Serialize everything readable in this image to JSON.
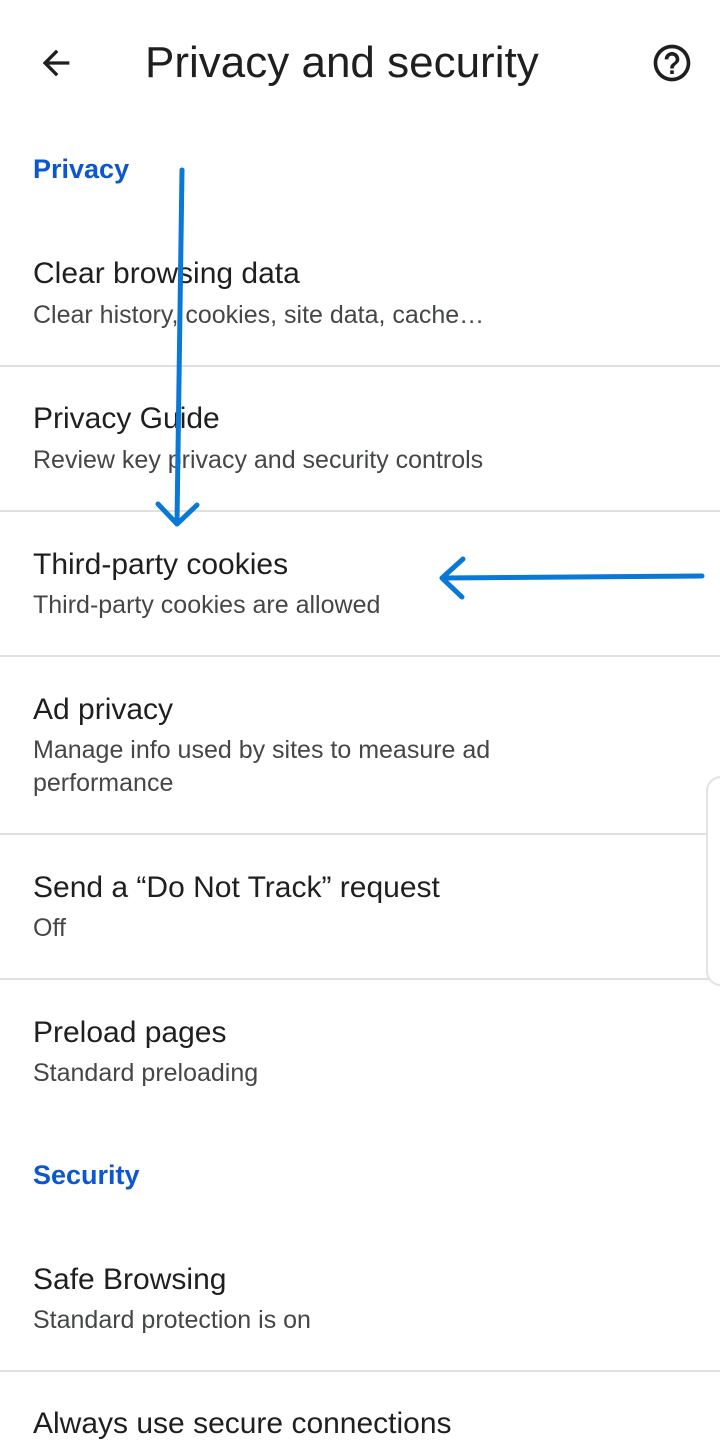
{
  "header": {
    "title": "Privacy and security",
    "back_icon": "arrow-back-icon",
    "help_icon": "help-circle-icon"
  },
  "sections": {
    "privacy_label": "Privacy",
    "security_label": "Security"
  },
  "privacy_items": [
    {
      "title": "Clear browsing data",
      "summary": "Clear history, cookies, site data, cache…"
    },
    {
      "title": "Privacy Guide",
      "summary": "Review key privacy and security controls"
    },
    {
      "title": "Third-party cookies",
      "summary": "Third-party cookies are allowed"
    },
    {
      "title": "Ad privacy",
      "summary": "Manage info used by sites to measure ad performance"
    },
    {
      "title": "Send a “Do Not Track” request",
      "summary": "Off"
    },
    {
      "title": "Preload pages",
      "summary": "Standard preloading"
    }
  ],
  "security_items": [
    {
      "title": "Safe Browsing",
      "summary": "Standard protection is on"
    },
    {
      "title": "Always use secure connections",
      "summary": ""
    }
  ],
  "colors": {
    "accent": "#0b57d0",
    "annotation_arrow": "#0a78d6",
    "divider": "#e0e0e0"
  }
}
